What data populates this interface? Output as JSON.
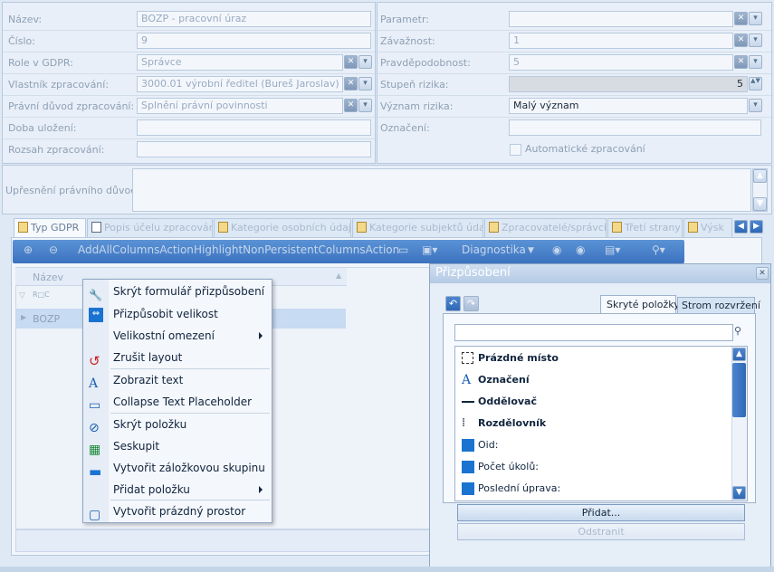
{
  "form_left": {
    "rows": [
      {
        "label": "Název:",
        "value": "BOZP - pracovní úraz",
        "has_buttons": false
      },
      {
        "label": "Číslo:",
        "value": "9",
        "has_buttons": false
      },
      {
        "label": "Role v GDPR:",
        "value": "Správce",
        "has_buttons": true
      },
      {
        "label": "Vlastník zpracování:",
        "value": "3000.01 výrobní ředitel (Bureš Jaroslav)",
        "has_buttons": true
      },
      {
        "label": "Právní důvod zpracování:",
        "value": "Splnění právní povinnosti",
        "has_buttons": true
      },
      {
        "label": "Doba uložení:",
        "value": "",
        "has_buttons": false
      },
      {
        "label": "Rozsah zpracování:",
        "value": "",
        "has_buttons": false
      }
    ],
    "legal_reason_detail_label": "Upřesnění právního důvodu:"
  },
  "form_right": {
    "rows": [
      {
        "label": "Parametr:",
        "value": ""
      },
      {
        "label": "Závažnost:",
        "value": "1"
      },
      {
        "label": "Pravděpodobnost:",
        "value": "5"
      },
      {
        "label": "Stupeň rizika:",
        "value": "5"
      },
      {
        "label": "Význam rizika:",
        "value": "Malý význam"
      },
      {
        "label": "Označení:",
        "value": ""
      }
    ],
    "auto_processing_label": "Automatické zpracování"
  },
  "tabs": [
    "Typ GDPR",
    "Popis účelu zpracování",
    "Kategorie osobních údajů",
    "Kategorie subjektů údajů",
    "Zpracovatelé/správci",
    "Třetí strany",
    "Výsk"
  ],
  "toolbar": {
    "add_all_columns": "AddAllColumnsAction",
    "highlight_non_persistent": "HighlightNonPersistentColumnsAction",
    "diagnostika": "Diagnostika"
  },
  "grid": {
    "column_header": "Název",
    "filter_placeholder": "R□C",
    "rows": [
      "BOZP"
    ]
  },
  "context_menu": {
    "items": [
      {
        "label": "Skrýt formulář přizpůsobení",
        "icon": "wrench-icon",
        "submenu": false
      },
      {
        "label": "Přizpůsobit velikost",
        "icon": "resize-icon",
        "submenu": false
      },
      {
        "label": "Velikostní omezení",
        "icon": "",
        "submenu": true
      },
      {
        "label": "Zrušit layout",
        "icon": "undo-icon",
        "submenu": false
      },
      {
        "label": "Zobrazit text",
        "icon": "text-eye-icon",
        "submenu": false
      },
      {
        "label": "Collapse Text Placeholder",
        "icon": "placeholder-icon",
        "submenu": false
      },
      {
        "label": "Skrýt položku",
        "icon": "hide-eye-icon",
        "submenu": false
      },
      {
        "label": "Seskupit",
        "icon": "group-icon",
        "submenu": false
      },
      {
        "label": "Vytvořit záložkovou skupinu",
        "icon": "tab-group-icon",
        "submenu": false
      },
      {
        "label": "Přidat položku",
        "icon": "",
        "submenu": true
      },
      {
        "label": "Vytvořit prázdný prostor",
        "icon": "empty-space-icon",
        "submenu": false
      }
    ]
  },
  "customization_panel": {
    "title": "Přizpůsobení",
    "tabs": [
      "Skryté položky",
      "Strom rozvržení"
    ],
    "search_placeholder": "",
    "items": [
      {
        "label": "Prázdné místo",
        "bold": true,
        "icon": "empty-space-icon"
      },
      {
        "label": "Označení",
        "bold": true,
        "icon": "label-a-icon"
      },
      {
        "label": "Oddělovač",
        "bold": true,
        "icon": "separator-icon"
      },
      {
        "label": "Rozdělovník",
        "bold": true,
        "icon": "splitter-icon"
      },
      {
        "label": "Oid:",
        "bold": false,
        "icon": "field-icon"
      },
      {
        "label": "Počet úkolů:",
        "bold": false,
        "icon": "field-icon"
      },
      {
        "label": "Poslední úprava:",
        "bold": false,
        "icon": "field-icon"
      }
    ],
    "add_button": "Přidat...",
    "remove_button": "Odstranit"
  },
  "colors": {
    "accent": "#1a73d0",
    "menu_text": "#10243e",
    "disabled_text": "#9aaac0"
  }
}
